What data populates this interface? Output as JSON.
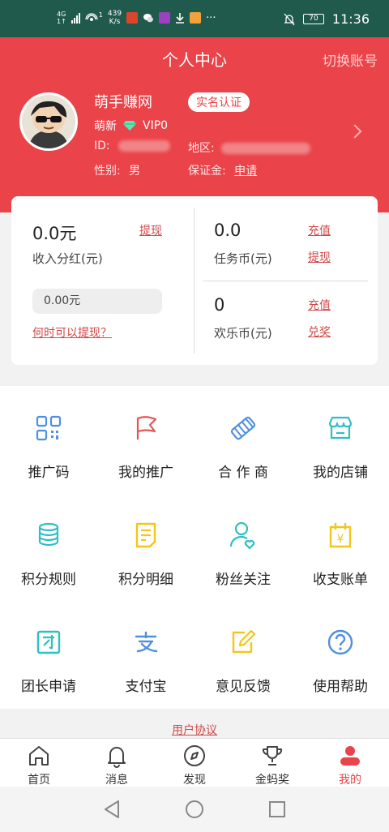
{
  "status_bar": {
    "network": "4G",
    "net_sub": "1↑",
    "signal_sup": "1",
    "speed_value": "439",
    "speed_unit": "K/s",
    "battery": "70",
    "time": "11:36"
  },
  "header": {
    "title": "个人中心",
    "switch_account": "切换账号",
    "username": "萌手赚网",
    "realname_badge": "实名认证",
    "level": "萌新",
    "vip": "VIP0",
    "id_label": "ID:",
    "region_label": "地区:",
    "gender_label": "性别:",
    "gender_value": "男",
    "deposit_label": "保证金:",
    "deposit_link": "申请"
  },
  "wallet": {
    "income_amount": "0.0元",
    "income_withdraw": "提现",
    "income_label": "收入分红(元)",
    "income_input": "0.00元",
    "when_withdraw": "何时可以提现？",
    "task_amount": "0.0",
    "task_recharge": "充值",
    "task_withdraw": "提现",
    "task_label": "任务币(元)",
    "happy_amount": "0",
    "happy_recharge": "充值",
    "happy_redeem": "兑奖",
    "happy_label": "欢乐币(元)"
  },
  "grid": [
    {
      "label": "推广码",
      "icon": "qrcode-icon"
    },
    {
      "label": "我的推广",
      "icon": "flag-icon"
    },
    {
      "label": "合 作 商",
      "icon": "handshake-icon"
    },
    {
      "label": "我的店铺",
      "icon": "store-icon"
    },
    {
      "label": "积分规则",
      "icon": "coins-icon"
    },
    {
      "label": "积分明细",
      "icon": "document-icon"
    },
    {
      "label": "粉丝关注",
      "icon": "user-heart-icon"
    },
    {
      "label": "收支账单",
      "icon": "bill-icon"
    },
    {
      "label": "团长申请",
      "icon": "group-leader-icon"
    },
    {
      "label": "支付宝",
      "icon": "alipay-icon"
    },
    {
      "label": "意见反馈",
      "icon": "feedback-icon"
    },
    {
      "label": "使用帮助",
      "icon": "help-icon"
    }
  ],
  "user_agreement": "用户协议",
  "tabs": [
    {
      "label": "首页",
      "icon": "home-icon"
    },
    {
      "label": "消息",
      "icon": "bell-icon"
    },
    {
      "label": "发现",
      "icon": "compass-icon"
    },
    {
      "label": "金蚂奖",
      "icon": "trophy-icon"
    },
    {
      "label": "我的",
      "icon": "profile-icon",
      "active": true
    }
  ],
  "colors": {
    "status_bar": "#1f5a4d",
    "brand_red": "#ea4349",
    "link_red": "#d04848",
    "icon_blue": "#4e8fe0",
    "icon_teal": "#2fbfc4",
    "icon_yellow": "#f5c51b",
    "icon_red": "#e45757"
  }
}
